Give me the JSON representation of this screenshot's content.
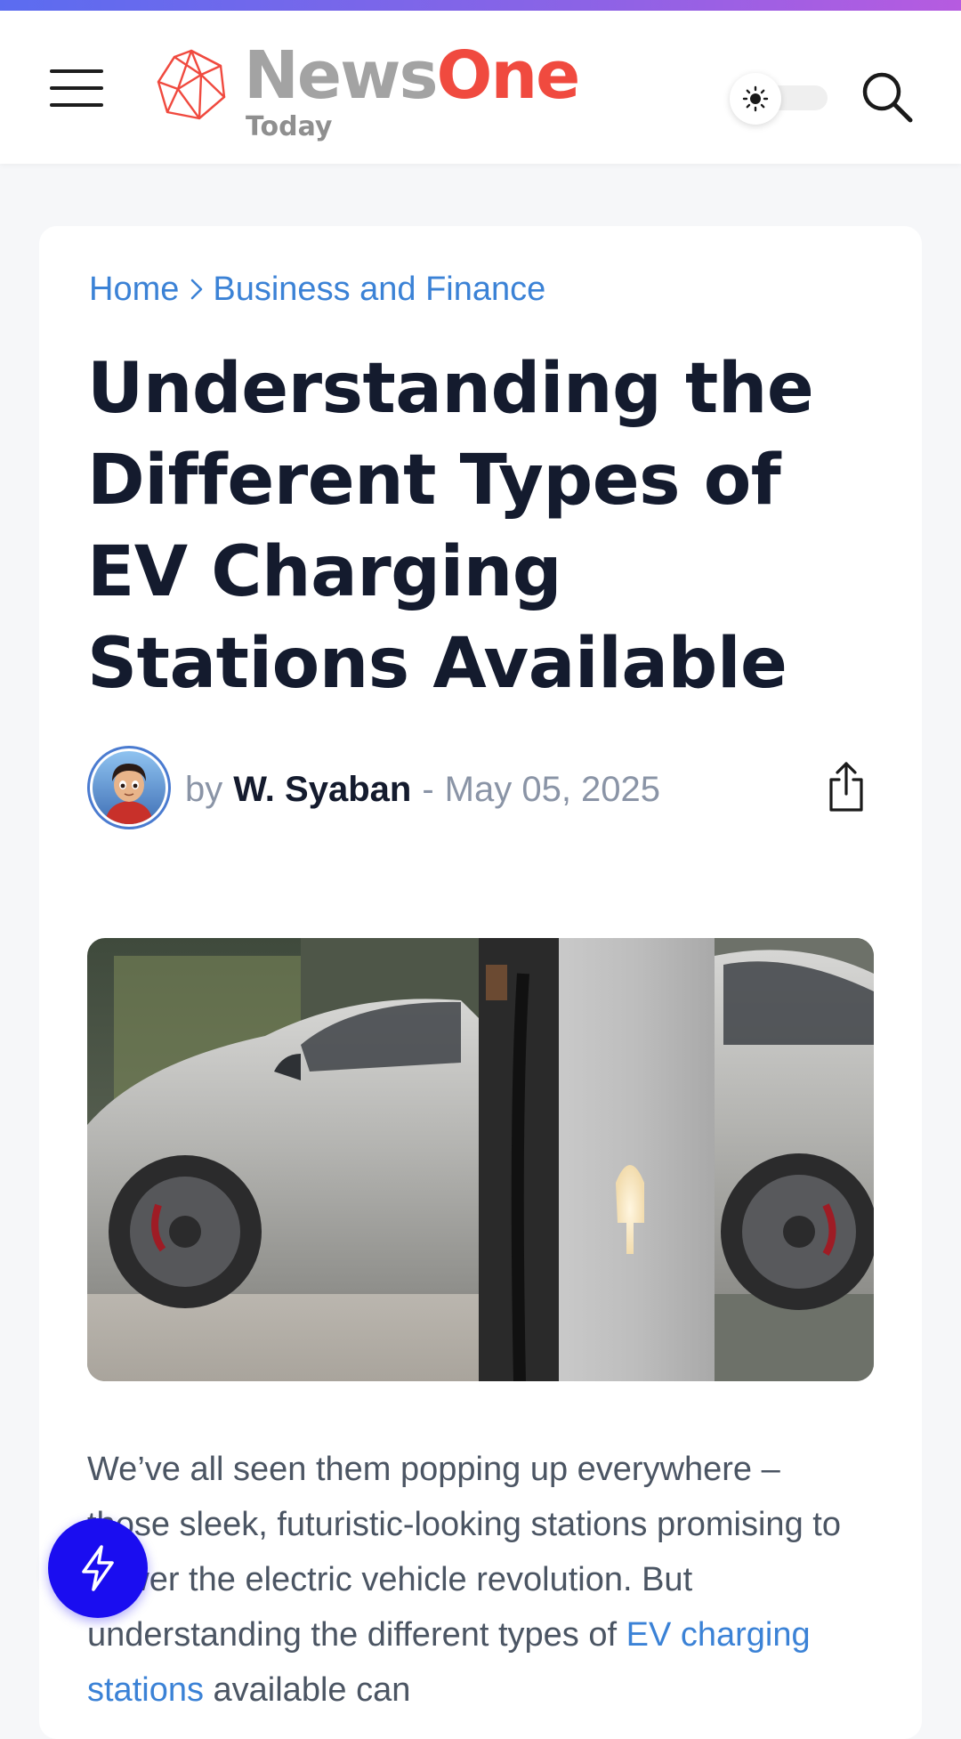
{
  "header": {
    "logo": {
      "word_news": "News",
      "word_one": "One",
      "tagline": "Today"
    },
    "menu_icon": "hamburger-icon",
    "theme_toggle_icon": "sun-icon",
    "search_icon": "search-icon"
  },
  "breadcrumb": {
    "home": "Home",
    "separator_icon": "chevron-right-icon",
    "category": "Business and Finance"
  },
  "article": {
    "title": "Understanding the Different Types of EV Charging Stations Available",
    "byline_prefix": "by",
    "author": "W. Syaban",
    "date_separator": "-",
    "date": "May 05, 2025",
    "share_icon": "share-icon",
    "body_before_link": "We’ve all seen them popping up everywhere – those sleek, futuristic-looking stations promising to power the electric vehicle revolution. But understanding the different types of ",
    "body_link": "EV charging stations",
    "body_after_link": " available can"
  },
  "fab": {
    "icon": "lightning-icon"
  },
  "colors": {
    "accent_link": "#3b82d6",
    "title_text": "#141b2e",
    "brand_red": "#f04a3f",
    "fab_blue": "#1a0df0"
  }
}
